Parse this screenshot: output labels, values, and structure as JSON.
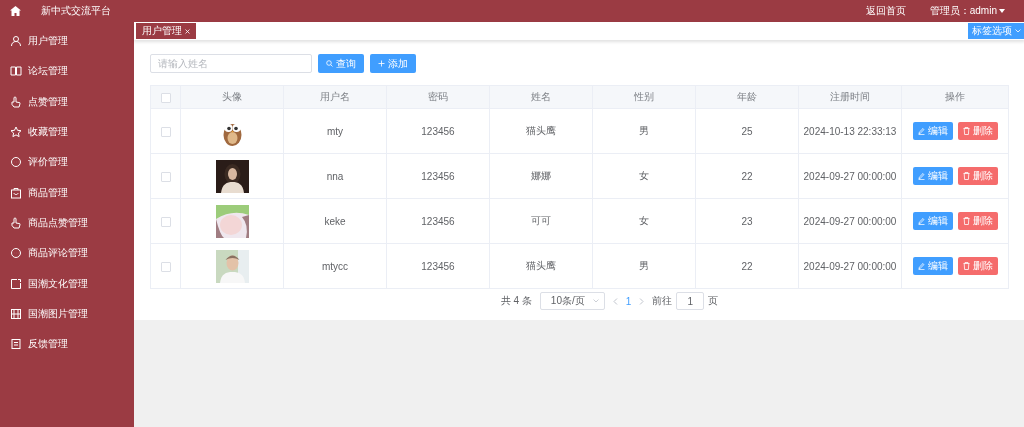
{
  "header": {
    "title": "新中式交流平台",
    "home_link": "返回首页",
    "user": "管理员：admin"
  },
  "sidebar": {
    "items": [
      {
        "label": "用户管理"
      },
      {
        "label": "论坛管理"
      },
      {
        "label": "点赞管理"
      },
      {
        "label": "收藏管理"
      },
      {
        "label": "评价管理"
      },
      {
        "label": "商品管理"
      },
      {
        "label": "商品点赞管理"
      },
      {
        "label": "商品评论管理"
      },
      {
        "label": "国潮文化管理"
      },
      {
        "label": "国潮图片管理"
      },
      {
        "label": "反馈管理"
      }
    ]
  },
  "tabs": [
    {
      "label": "用户管理",
      "selected": true
    }
  ],
  "tab_options": "标签选项",
  "search": {
    "placeholder": "请输入姓名",
    "buttons": [
      "查询",
      "添加"
    ]
  },
  "table": {
    "select_all": {
      "checked": false
    },
    "columns": [
      "头像",
      "用户名",
      "密码",
      "姓名",
      "性别",
      "年龄",
      "注册时间",
      "操作"
    ],
    "rows": [
      {
        "checked": false,
        "username": "mty",
        "password": "123456",
        "name": "猫头鹰",
        "gender": "男",
        "age": "25",
        "registered": "2024-10-13 22:33:13",
        "actions": [
          "编辑",
          "删除"
        ]
      },
      {
        "checked": false,
        "username": "nna",
        "password": "123456",
        "name": "娜娜",
        "gender": "女",
        "age": "22",
        "registered": "2024-09-27 00:00:00",
        "actions": [
          "编辑",
          "删除"
        ]
      },
      {
        "checked": false,
        "username": "keke",
        "password": "123456",
        "name": "可可",
        "gender": "女",
        "age": "23",
        "registered": "2024-09-27 00:00:00",
        "actions": [
          "编辑",
          "删除"
        ]
      },
      {
        "checked": false,
        "username": "mtycc",
        "password": "123456",
        "name": "猫头鹰",
        "gender": "男",
        "age": "22",
        "registered": "2024-09-27 00:00:00",
        "actions": [
          "编辑",
          "删除"
        ]
      }
    ]
  },
  "pagination": {
    "total": "共 4 条",
    "page_size": "10条/页",
    "pages": [
      {
        "label": "1",
        "selected": true
      }
    ],
    "goto_label": "前往",
    "goto_value": "1",
    "goto_suffix": "页"
  }
}
